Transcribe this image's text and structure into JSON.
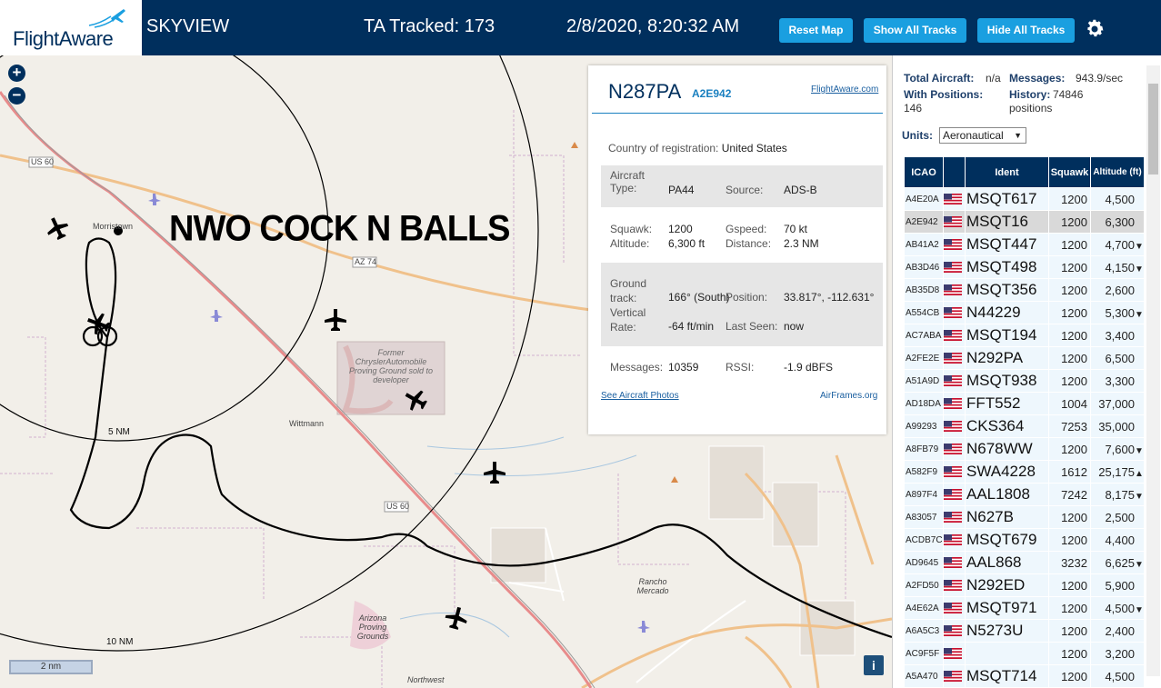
{
  "header": {
    "brand": "FlightAware",
    "app_title": "SKYVIEW",
    "tracked": "TA Tracked: 173",
    "datetime": "2/8/2020, 8:20:32 AM",
    "buttons": {
      "reset_map": "Reset Map",
      "show_all": "Show All Tracks",
      "hide_all": "Hide All Tracks"
    },
    "gear_icon": "gear-icon"
  },
  "map": {
    "overlay_text": "NWO COCK N BALLS",
    "zoom_in": "+",
    "zoom_out": "−",
    "scale": "2 nm",
    "info": "i",
    "ring_5nm": "5 NM",
    "ring_10nm": "10 NM",
    "labels": {
      "us60_a": "US 60",
      "us60_b": "US 60",
      "az74": "AZ 74",
      "morristown": "Morristown",
      "wittmann": "Wittmann",
      "former_chrysler": "Former ChryslerAutomobile Proving Ground sold to developer",
      "rancho": "Rancho Mercado",
      "arizona_proving": "Arizona Proving Grounds",
      "northwest": "Northwest"
    },
    "colors": {
      "land": "#f2efe9",
      "major_road": "#f0c18b",
      "highway": "#e88b8b",
      "track": "#000000"
    }
  },
  "popup": {
    "ident": "N287PA",
    "icao": "A2E942",
    "fa_link": "FlightAware.com",
    "country_label": "Country of registration:",
    "country_value": "United States",
    "aircraft_type_label": "Aircraft Type:",
    "aircraft_type_value": "PA44",
    "source_label": "Source:",
    "source_value": "ADS-B",
    "squawk_label": "Squawk:",
    "squawk_value": "1200",
    "gspeed_label": "Gspeed:",
    "gspeed_value": "70 kt",
    "altitude_label": "Altitude:",
    "altitude_value": "6,300 ft",
    "distance_label": "Distance:",
    "distance_value": "2.3 NM",
    "ground_track_label": "Ground track:",
    "ground_track_value": "166° (South)",
    "position_label": "Position:",
    "position_value": "33.817°, -112.631°",
    "vertical_rate_label": "Vertical Rate:",
    "vertical_rate_value": "-64 ft/min",
    "last_seen_label": "Last Seen:",
    "last_seen_value": "now",
    "messages_label": "Messages:",
    "messages_value": "10359",
    "rssi_label": "RSSI:",
    "rssi_value": "-1.9 dBFS",
    "photos_link": "See Aircraft Photos",
    "airframes_link": "AirFrames.org"
  },
  "sidebar": {
    "total_aircraft_label": "Total Aircraft:",
    "total_aircraft_value": "n/a",
    "messages_label": "Messages:",
    "messages_value": "943.9/sec",
    "with_positions_label": "With Positions:",
    "with_positions_value": "146",
    "history_label": "History:",
    "history_value": "74846 positions",
    "units_label": "Units:",
    "units_value": "Aeronautical",
    "columns": [
      "ICAO",
      "",
      "Ident",
      "Squawk",
      "Altitude (ft)"
    ],
    "rows": [
      {
        "icao": "A4E20A",
        "ident": "MSQT617",
        "squawk": "1200",
        "alt": "4,500",
        "trend": ""
      },
      {
        "icao": "A2E942",
        "ident": "MSQT16",
        "squawk": "1200",
        "alt": "6,300",
        "trend": "",
        "selected": true
      },
      {
        "icao": "AB41A2",
        "ident": "MSQT447",
        "squawk": "1200",
        "alt": "4,700",
        "trend": "▼"
      },
      {
        "icao": "AB3D46",
        "ident": "MSQT498",
        "squawk": "1200",
        "alt": "4,150",
        "trend": "▼"
      },
      {
        "icao": "AB35D8",
        "ident": "MSQT356",
        "squawk": "1200",
        "alt": "2,600",
        "trend": ""
      },
      {
        "icao": "A554CB",
        "ident": "N44229",
        "squawk": "1200",
        "alt": "5,300",
        "trend": "▼"
      },
      {
        "icao": "AC7ABA",
        "ident": "MSQT194",
        "squawk": "1200",
        "alt": "3,400",
        "trend": ""
      },
      {
        "icao": "A2FE2E",
        "ident": "N292PA",
        "squawk": "1200",
        "alt": "6,500",
        "trend": ""
      },
      {
        "icao": "A51A9D",
        "ident": "MSQT938",
        "squawk": "1200",
        "alt": "3,300",
        "trend": ""
      },
      {
        "icao": "AD18DA",
        "ident": "FFT552",
        "squawk": "1004",
        "alt": "37,000",
        "trend": ""
      },
      {
        "icao": "A99293",
        "ident": "CKS364",
        "squawk": "7253",
        "alt": "35,000",
        "trend": ""
      },
      {
        "icao": "A8FB79",
        "ident": "N678WW",
        "squawk": "1200",
        "alt": "7,600",
        "trend": "▼"
      },
      {
        "icao": "A582F9",
        "ident": "SWA4228",
        "squawk": "1612",
        "alt": "25,175",
        "trend": "▲"
      },
      {
        "icao": "A897F4",
        "ident": "AAL1808",
        "squawk": "7242",
        "alt": "8,175",
        "trend": "▼"
      },
      {
        "icao": "A83057",
        "ident": "N627B",
        "squawk": "1200",
        "alt": "2,500",
        "trend": ""
      },
      {
        "icao": "ACDB7C",
        "ident": "MSQT679",
        "squawk": "1200",
        "alt": "4,400",
        "trend": ""
      },
      {
        "icao": "AD9645",
        "ident": "AAL868",
        "squawk": "3232",
        "alt": "6,625",
        "trend": "▼"
      },
      {
        "icao": "A2FD50",
        "ident": "N292ED",
        "squawk": "1200",
        "alt": "5,900",
        "trend": ""
      },
      {
        "icao": "A4E62A",
        "ident": "MSQT971",
        "squawk": "1200",
        "alt": "4,500",
        "trend": "▼"
      },
      {
        "icao": "A6A5C3",
        "ident": "N5273U",
        "squawk": "1200",
        "alt": "2,400",
        "trend": ""
      },
      {
        "icao": "AC9F5F",
        "ident": "",
        "squawk": "1200",
        "alt": "3,200",
        "trend": ""
      },
      {
        "icao": "A5A470",
        "ident": "MSQT714",
        "squawk": "1200",
        "alt": "4,500",
        "trend": ""
      }
    ]
  }
}
